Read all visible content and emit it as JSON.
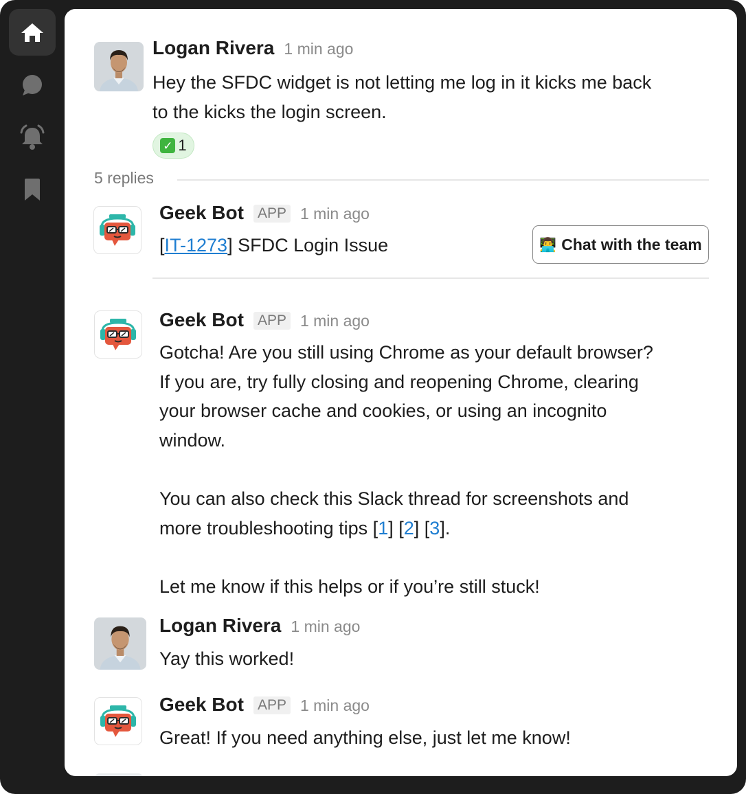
{
  "nav": {
    "items": [
      {
        "icon": "home-icon",
        "active": true
      },
      {
        "icon": "chat-bubble-icon",
        "active": false
      },
      {
        "icon": "alarm-bell-icon",
        "active": false
      },
      {
        "icon": "bookmark-icon",
        "active": false
      }
    ]
  },
  "thread": {
    "root": {
      "author": "Logan Rivera",
      "time": "1 min ago",
      "line1": "Hey the SFDC widget is not letting me log in it kicks me back",
      "line2": "to the kicks the login screen.",
      "reaction": {
        "emoji": "✅",
        "count": "1"
      }
    },
    "replies_label": "5 replies",
    "replies": [
      {
        "author": "Geek Bot",
        "badge": "APP",
        "time": "1 min ago",
        "ticket_open": "[",
        "ticket_id": "IT-1273",
        "ticket_close": "]",
        "ticket_title": " SFDC Login Issue",
        "action_emoji": "👨‍💻",
        "action_label": "Chat with the team"
      },
      {
        "author": "Geek Bot",
        "badge": "APP",
        "time": "1 min ago",
        "p1_l1": "Gotcha! Are you still using Chrome as your default browser?",
        "p1_l2": "If you are, try fully closing and reopening Chrome, clearing",
        "p1_l3": "your browser cache and cookies, or using an incognito",
        "p1_l4": "window.",
        "p2_l1": "You can also check this Slack thread for screenshots and",
        "p2_l2_prefix": "more troubleshooting tips [",
        "ref1": "1",
        "ref_sep1": "] [",
        "ref2": "2",
        "ref_sep2": "] [",
        "ref3": "3",
        "p2_l2_suffix": "].",
        "p3": "Let me know if this helps or if you’re still stuck!"
      },
      {
        "author": "Logan Rivera",
        "time": "1 min ago",
        "text": "Yay this worked!"
      },
      {
        "author": "Geek Bot",
        "badge": "APP",
        "time": "1 min ago",
        "text": "Great! If you need anything else, just let me know!"
      }
    ]
  }
}
